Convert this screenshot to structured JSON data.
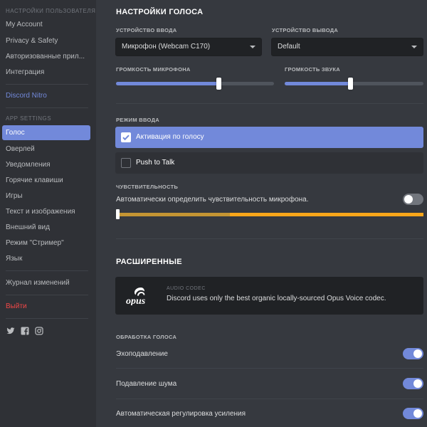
{
  "sidebar": {
    "user_settings_header": "НАСТРОЙКИ ПОЛЬЗОВАТЕЛЯ",
    "user_items": [
      {
        "label": "My Account"
      },
      {
        "label": "Privacy & Safety"
      },
      {
        "label": "Авторизованные прил..."
      },
      {
        "label": "Интеграция"
      }
    ],
    "nitro_label": "Discord Nitro",
    "app_settings_header": "APP SETTINGS",
    "app_items": [
      {
        "label": "Голос",
        "active": true
      },
      {
        "label": "Оверлей"
      },
      {
        "label": "Уведомления"
      },
      {
        "label": "Горячие клавиши"
      },
      {
        "label": "Игры"
      },
      {
        "label": "Текст и изображения"
      },
      {
        "label": "Внешний вид"
      },
      {
        "label": "Режим \"Стример\""
      },
      {
        "label": "Язык"
      }
    ],
    "changelog_label": "Журнал изменений",
    "logout_label": "Выйти",
    "social_icons": [
      "twitter-icon",
      "facebook-icon",
      "instagram-icon"
    ]
  },
  "voice": {
    "title": "НАСТРОЙКИ ГОЛОСА",
    "input_device_label": "УСТРОЙСТВО ВВОДА",
    "input_device_value": "Микрофон (Webcam C170)",
    "output_device_label": "УСТРОЙСТВО ВЫВОДА",
    "output_device_value": "Default",
    "mic_volume_label": "ГРОМКОСТЬ МИКРОФОНА",
    "mic_volume_level": 0.65,
    "sound_volume_label": "ГРОМКОСТЬ ЗВУКА",
    "sound_volume_level": 0.47,
    "input_mode_label": "РЕЖИМ ВВОДА",
    "input_modes": [
      {
        "label": "Активация по голосу",
        "selected": true
      },
      {
        "label": "Push to Talk",
        "selected": false
      }
    ],
    "sensitivity_label": "ЧУВСТВИТЕЛЬНОСТЬ",
    "auto_sensitivity_label": "Автоматически определить чувствительность микрофона.",
    "auto_sensitivity_on": false,
    "sensitivity_level_fraction": 0.37
  },
  "advanced": {
    "title": "РАСШИРЕННЫЕ",
    "codec_logo_text": "opus",
    "codec_label": "AUDIO CODEC",
    "codec_description": "Discord uses only the best organic locally-sourced Opus Voice codec.",
    "processing_label": "ОБРАБОТКА ГОЛОСА",
    "processing_options": [
      {
        "label": "Эхоподавление",
        "on": true
      },
      {
        "label": "Подавление шума",
        "on": true
      },
      {
        "label": "Автоматическая регулировка усиления",
        "on": true
      }
    ]
  },
  "colors": {
    "accent": "#7289da",
    "danger": "#f04747",
    "sensitivity_level": "#c49533",
    "sensitivity_threshold": "#faa61a"
  }
}
